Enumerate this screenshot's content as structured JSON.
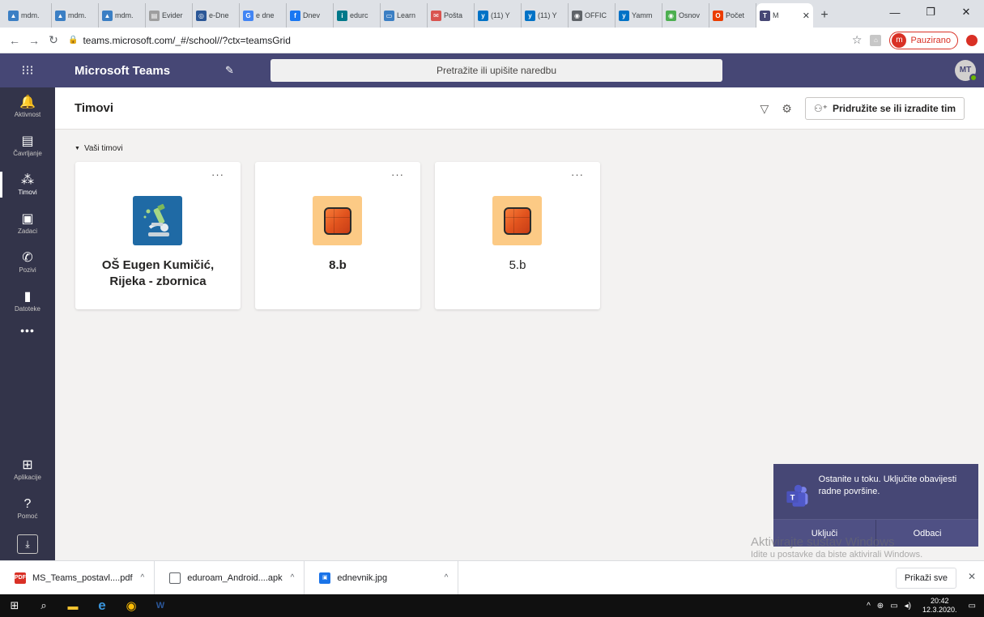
{
  "browser": {
    "tabs": [
      {
        "label": "mdm.",
        "color": "#3b7fc4",
        "glyph": "▲"
      },
      {
        "label": "mdm.",
        "color": "#3b7fc4",
        "glyph": "▲"
      },
      {
        "label": "mdm.",
        "color": "#3b7fc4",
        "glyph": "▲"
      },
      {
        "label": "Evider",
        "color": "#9e9e9e",
        "glyph": "▤"
      },
      {
        "label": "e-Dne",
        "color": "#2b5797",
        "glyph": "◎"
      },
      {
        "label": "e dne",
        "color": "#4285f4",
        "glyph": "G"
      },
      {
        "label": "Dnev",
        "color": "#1877f2",
        "glyph": "f"
      },
      {
        "label": "edurc",
        "color": "#00788a",
        "glyph": "i"
      },
      {
        "label": "Learn",
        "color": "#3b7fc4",
        "glyph": "▭"
      },
      {
        "label": "Pošta",
        "color": "#d9534f",
        "glyph": "✉"
      },
      {
        "label": "(11) Y",
        "color": "#0072c6",
        "glyph": "y"
      },
      {
        "label": "(11) Y",
        "color": "#0072c6",
        "glyph": "y"
      },
      {
        "label": "OFFIC",
        "color": "#5f6368",
        "glyph": "◉"
      },
      {
        "label": "Yamm",
        "color": "#0072c6",
        "glyph": "y"
      },
      {
        "label": "Osnov",
        "color": "#4caf50",
        "glyph": "◉"
      },
      {
        "label": "Počet",
        "color": "#eb3c00",
        "glyph": "O"
      }
    ],
    "active_tab": {
      "label": "M",
      "color": "#464775",
      "glyph": "T"
    },
    "new_tab": "+",
    "window_controls": {
      "minimize": "—",
      "maximize": "❐",
      "close": "✕"
    },
    "url": "teams.microsoft.com/_#/school//?ctx=teamsGrid",
    "profile_initial": "m",
    "profile_status": "Pauzirano"
  },
  "teams": {
    "app_title": "Microsoft Teams",
    "search_placeholder": "Pretražite ili upišite naredbu",
    "user_initials": "MT",
    "rail": [
      {
        "id": "aktivnost",
        "label": "Aktivnost",
        "glyph": "🔔"
      },
      {
        "id": "cavrljanje",
        "label": "Čavrljanje",
        "glyph": "▤"
      },
      {
        "id": "timovi",
        "label": "Timovi",
        "glyph": "⁂"
      },
      {
        "id": "zadaci",
        "label": "Zadaci",
        "glyph": "▣"
      },
      {
        "id": "pozivi",
        "label": "Pozivi",
        "glyph": "✆"
      },
      {
        "id": "datoteke",
        "label": "Datoteke",
        "glyph": "▮"
      }
    ],
    "rail_more": "•••",
    "rail_bottom": [
      {
        "id": "aplikacije",
        "label": "Aplikacije",
        "glyph": "⊞"
      },
      {
        "id": "pomoc",
        "label": "Pomoć",
        "glyph": "?"
      }
    ],
    "page_title": "Timovi",
    "join_button": "Pridružite se ili izradite tim",
    "section_label": "Vaši timovi",
    "team_cards": [
      {
        "name": "OŠ Eugen Kumičić, Rijeka - zbornica",
        "bold": true,
        "tile": "microscope"
      },
      {
        "name": "8.b",
        "bold": true,
        "tile": "orange"
      },
      {
        "name": "5.b",
        "bold": false,
        "tile": "orange"
      }
    ],
    "card_more": "···"
  },
  "notification": {
    "message": "Ostanite u toku. Uključite obavijesti radne površine.",
    "enable": "Uključi",
    "dismiss": "Odbaci"
  },
  "watermark": {
    "line1": "Aktivirajte sustav Windows",
    "line2": "Idite u postavke da biste aktivirali Windows."
  },
  "downloads": {
    "items": [
      {
        "name": "MS_Teams_postavl....pdf",
        "kind": "pdf"
      },
      {
        "name": "eduroam_Android....apk",
        "kind": "doc"
      },
      {
        "name": "ednevnik.jpg",
        "kind": "img"
      }
    ],
    "show_all": "Prikaži sve"
  },
  "taskbar": {
    "time": "20:42",
    "date": "12.3.2020."
  },
  "colors": {
    "teams_purple": "#464775",
    "rail_dark": "#33344a",
    "orange_tile": "#fcca85",
    "science_tile": "#1f6aa5"
  }
}
